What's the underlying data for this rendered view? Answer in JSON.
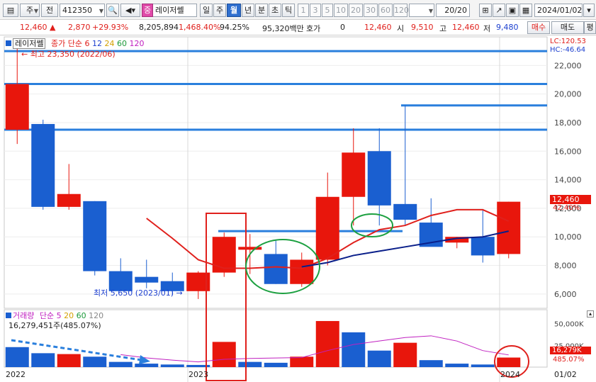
{
  "toolbar": {
    "period_select": "주",
    "market_select": "전",
    "code": "412350",
    "name_badge": "중",
    "name": "레이저쎌",
    "period_tabs": [
      "일",
      "주",
      "월",
      "년",
      "분",
      "초",
      "틱"
    ],
    "active_period": "월",
    "intervals": [
      "1",
      "3",
      "5",
      "10",
      "20",
      "30",
      "60",
      "120"
    ],
    "count": "20",
    "count_total": "/20",
    "date": "2024/01/02"
  },
  "quote": {
    "price": "12,460",
    "change": "2,870",
    "change_pct": "+29.93%",
    "volume": "8,205,894",
    "volume_ratio": "1,468.40%",
    "turnover": "94.25%",
    "amount": "95,320백만",
    "bid_label": "호가",
    "bid_value": "0",
    "last": "12,460",
    "open_label": "시",
    "open": "9,510",
    "high_label": "고",
    "high": "12,460",
    "low_label": "저",
    "low": "9,480",
    "buy_label": "매수",
    "sell_label": "매도",
    "eval_label": "평"
  },
  "price_panel": {
    "legend_name": "레이저쎌",
    "ma_label": "종가 단순",
    "ma_periods": [
      "6",
      "12",
      "24",
      "60",
      "120"
    ],
    "ma_colors": [
      "#e0201c",
      "#1c3fcf",
      "#d4a000",
      "#1c9a3a",
      "#c020c0"
    ],
    "high_note": "최고 23,350 (2022/06)",
    "low_note": "최저 5,650 (2023/01)",
    "lc": "LC:120.53",
    "hc": "HC:-46.64",
    "price_tag": "12,460",
    "pct_tag": "42.40%"
  },
  "volume_panel": {
    "title": "거래량",
    "ma_label": "단순",
    "ma_periods": [
      "5",
      "20",
      "60",
      "120"
    ],
    "value": "16,279,451주(485.07%)",
    "tag_value": "16,279K",
    "tag_pct": "485.07%"
  },
  "x_labels": [
    "2022",
    "2023",
    "2024",
    "01/02"
  ],
  "chart_data": {
    "type": "candlestick",
    "x": [
      "2022/04",
      "2022/05",
      "2022/06",
      "2022/07",
      "2022/08",
      "2022/09",
      "2022/10",
      "2022/11",
      "2022/12",
      "2023/01",
      "2023/02",
      "2023/03",
      "2023/04",
      "2023/05",
      "2023/06",
      "2023/07",
      "2023/08",
      "2023/09",
      "2023/10",
      "2023/11",
      "2023/12",
      "2024/01"
    ],
    "open": [
      null,
      17500,
      20700,
      12100,
      12500,
      7500,
      8200,
      7500,
      6200,
      9600,
      8700,
      7600,
      12700,
      15200,
      16500,
      15300,
      10900,
      9400,
      8900,
      9050,
      12460,
      12460
    ],
    "candles": [
      {
        "o": 17500,
        "h": 23350,
        "l": 16500,
        "c": 20700
      },
      {
        "o": 17900,
        "h": 18200,
        "l": 11900,
        "c": 12100
      },
      {
        "o": 12100,
        "h": 15100,
        "l": 11900,
        "c": 13000
      },
      {
        "o": 12500,
        "h": 12500,
        "l": 7300,
        "c": 7600
      },
      {
        "o": 7600,
        "h": 8500,
        "l": 6500,
        "c": 6200
      },
      {
        "o": 7200,
        "h": 8400,
        "l": 6400,
        "c": 6800
      },
      {
        "o": 6900,
        "h": 7500,
        "l": 5900,
        "c": 6200
      },
      {
        "o": 6200,
        "h": 7600,
        "l": 5650,
        "c": 7500
      },
      {
        "o": 7500,
        "h": 10300,
        "l": 7200,
        "c": 10000
      },
      {
        "o": 9100,
        "h": 10200,
        "l": 7400,
        "c": 9300
      },
      {
        "o": 8800,
        "h": 9800,
        "l": 6700,
        "c": 6700
      },
      {
        "o": 6700,
        "h": 8900,
        "l": 6500,
        "c": 8400
      },
      {
        "o": 8400,
        "h": 14500,
        "l": 8000,
        "c": 12800
      },
      {
        "o": 12800,
        "h": 17600,
        "l": 10800,
        "c": 15900
      },
      {
        "o": 16000,
        "h": 17600,
        "l": 10800,
        "c": 12200
      },
      {
        "o": 12300,
        "h": 19200,
        "l": 10800,
        "c": 11200
      },
      {
        "o": 11000,
        "h": 12700,
        "l": 9700,
        "c": 9300
      },
      {
        "o": 9600,
        "h": 10000,
        "l": 9200,
        "c": 10000
      },
      {
        "o": 10000,
        "h": 11900,
        "l": 8200,
        "c": 8700
      },
      {
        "o": 8800,
        "h": 12460,
        "l": 8500,
        "c": 12460
      }
    ],
    "ma6": [
      null,
      null,
      null,
      null,
      null,
      11300,
      9900,
      8400,
      7800,
      7800,
      7900,
      7800,
      8500,
      9600,
      10500,
      10800,
      11500,
      11900,
      11900,
      11100
    ],
    "ma12": [
      null,
      null,
      null,
      null,
      null,
      null,
      null,
      null,
      null,
      null,
      null,
      7900,
      8200,
      8700,
      9000,
      9300,
      9600,
      9900,
      10000,
      10400
    ],
    "volume": [
      [
        2300,
        1
      ],
      [
        1600,
        1
      ],
      [
        1500,
        0
      ],
      [
        1200,
        1
      ],
      [
        600,
        1
      ],
      [
        400,
        1
      ],
      [
        300,
        1
      ],
      [
        250,
        1
      ],
      [
        2900,
        0
      ],
      [
        600,
        1
      ],
      [
        500,
        1
      ],
      [
        1200,
        0
      ],
      [
        5300,
        0
      ],
      [
        4000,
        1
      ],
      [
        1900,
        1
      ],
      [
        2800,
        0
      ],
      [
        800,
        1
      ],
      [
        400,
        1
      ],
      [
        300,
        1
      ],
      [
        1100,
        0
      ]
    ],
    "vol_ma": [
      null,
      null,
      null,
      null,
      1440,
      1060,
      800,
      600,
      900,
      1000,
      1050,
      1100,
      1900,
      2600,
      3000,
      3400,
      3600,
      3000,
      1900,
      1400
    ],
    "ylim": [
      5000,
      24000
    ],
    "ytick_labels": [
      "6,000",
      "8,000",
      "10,000",
      "12,000",
      "14,000",
      "16,000",
      "18,000",
      "20,000",
      "22,000"
    ],
    "ytick_values": [
      6000,
      8000,
      10000,
      12000,
      14000,
      16000,
      18000,
      20000,
      22000
    ],
    "vol_ylim": [
      0,
      6600
    ],
    "vol_tick_labels": [
      "50,000K",
      "25,000K"
    ],
    "vol_tick_values": [
      5000,
      2500
    ],
    "hlines": [
      23000,
      20700,
      17500
    ],
    "colors": {
      "up": "#e8160c",
      "down": "#1a5fd0",
      "ma6": "#e0201c",
      "ma12": "#0a1f8a",
      "vol_ma": "#c020c0",
      "hline": "#2a7fdd",
      "highlight_green": "#1ca040",
      "highlight_red": "#e0201c"
    }
  }
}
